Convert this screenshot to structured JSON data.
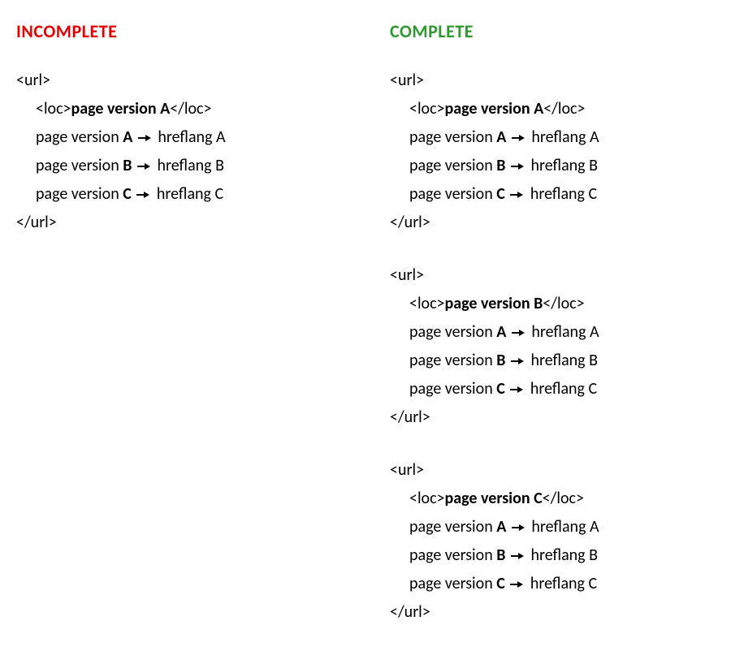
{
  "left": {
    "heading": "INCOMPLETE",
    "blocks": [
      {
        "open": "<url>",
        "loc_prefix": "<loc>",
        "loc_text": "page version A",
        "loc_suffix": "</loc>",
        "link_1_prefix": "page version ",
        "link_1_bold": "A",
        "link_1_dest": " hreflang A",
        "link_2_prefix": "page version ",
        "link_2_bold": "B",
        "link_2_dest": " hreflang B",
        "link_3_prefix": "page version ",
        "link_3_bold": "C",
        "link_3_dest": " hreflang C",
        "close": "</url>"
      }
    ]
  },
  "right": {
    "heading": "COMPLETE",
    "blocks": [
      {
        "open": "<url>",
        "loc_prefix": "<loc>",
        "loc_text": "page version A",
        "loc_suffix": "</loc>",
        "link_1_prefix": "page version ",
        "link_1_bold": "A",
        "link_1_dest": " hreflang A",
        "link_2_prefix": "page version ",
        "link_2_bold": "B",
        "link_2_dest": " hreflang B",
        "link_3_prefix": "page version ",
        "link_3_bold": "C",
        "link_3_dest": " hreflang C",
        "close": "</url>"
      },
      {
        "open": "<url>",
        "loc_prefix": "<loc>",
        "loc_text": "page version B",
        "loc_suffix": "</loc>",
        "link_1_prefix": "page version ",
        "link_1_bold": "A",
        "link_1_dest": " hreflang A",
        "link_2_prefix": "page version ",
        "link_2_bold": "B",
        "link_2_dest": " hreflang B",
        "link_3_prefix": "page version ",
        "link_3_bold": "C",
        "link_3_dest": " hreflang C",
        "close": "</url>"
      },
      {
        "open": "<url>",
        "loc_prefix": "<loc>",
        "loc_text": "page version C",
        "loc_suffix": "</loc>",
        "link_1_prefix": "page version ",
        "link_1_bold": "A",
        "link_1_dest": " hreflang A",
        "link_2_prefix": "page version ",
        "link_2_bold": "B",
        "link_2_dest": " hreflang B",
        "link_3_prefix": "page version ",
        "link_3_bold": "C",
        "link_3_dest": " hreflang C",
        "close": "</url>"
      }
    ]
  }
}
